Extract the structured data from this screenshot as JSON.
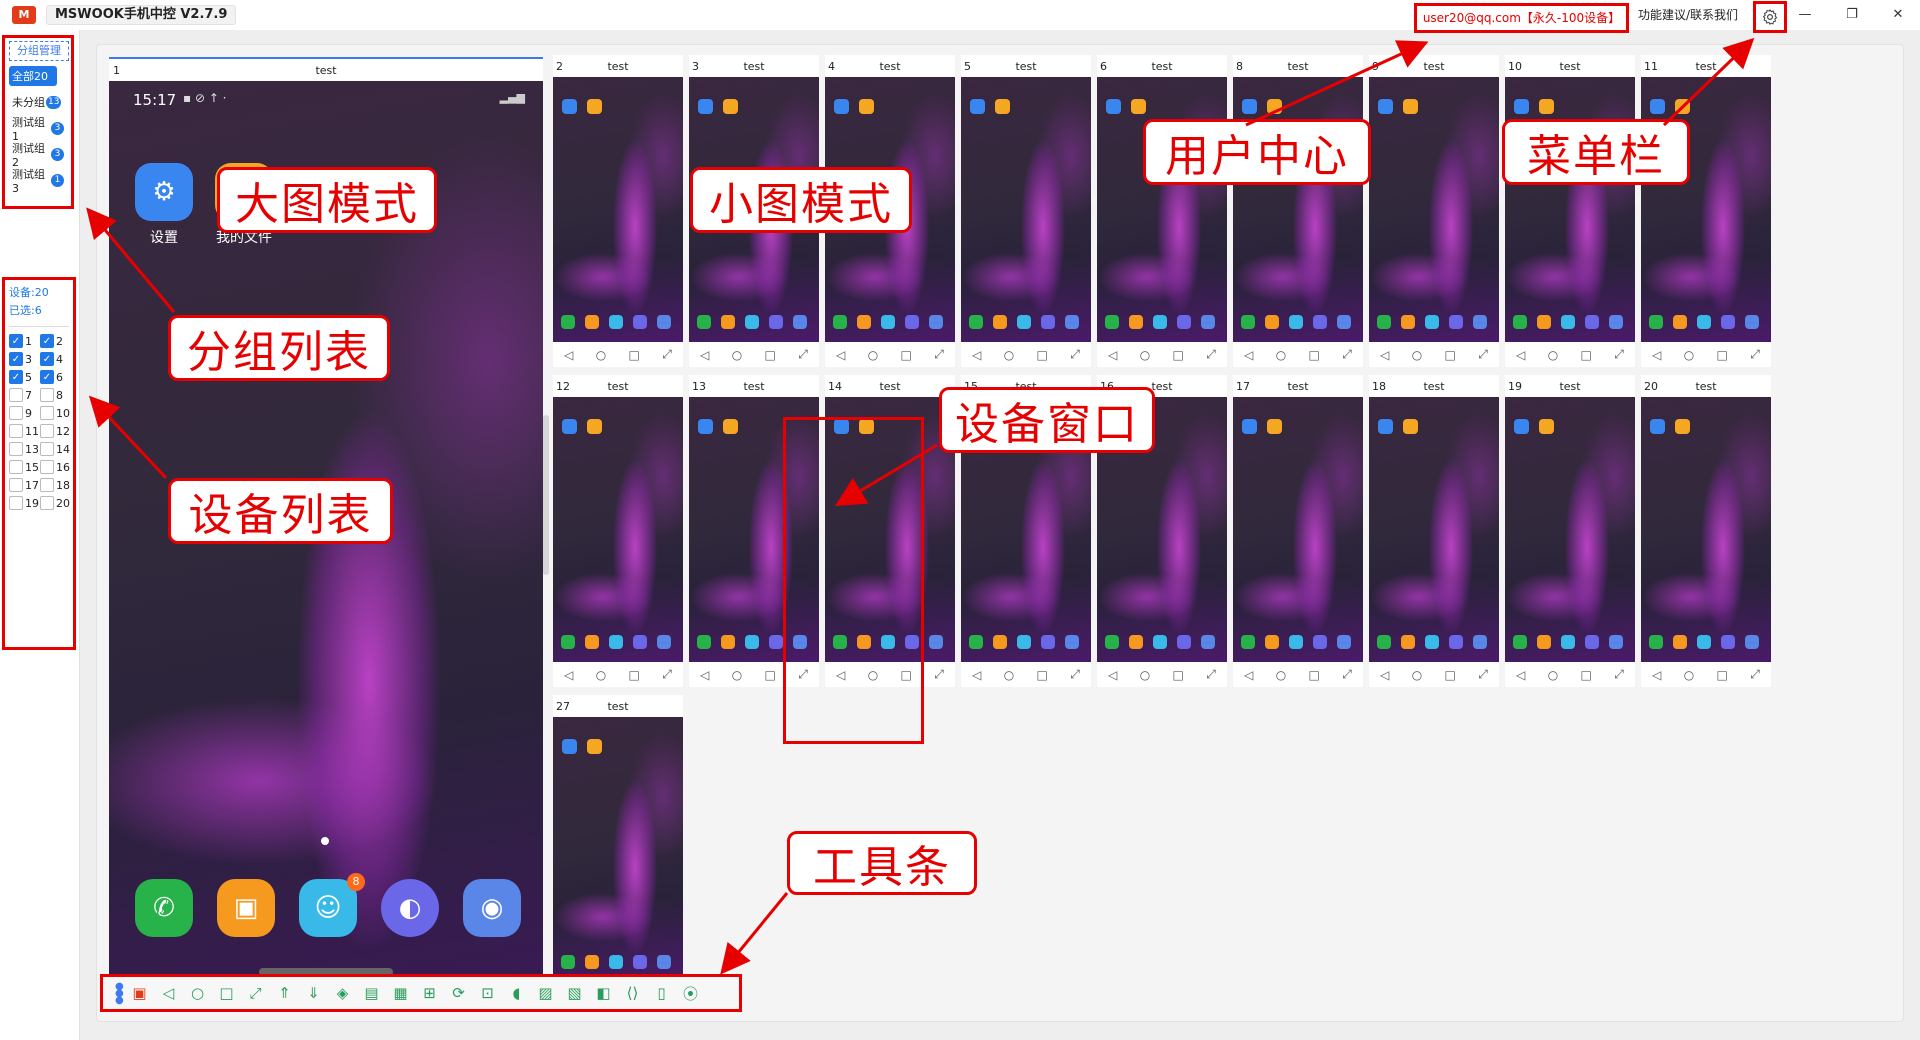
{
  "app": {
    "logo": "M",
    "title": "MSWOOK手机中控 V2.7.9"
  },
  "header": {
    "user_badge": "user20@qq.com【永久-100设备】",
    "feedback": "功能建议/联系我们"
  },
  "groups": {
    "manage": "分组管理",
    "items": [
      {
        "label": "全部",
        "count": "20"
      },
      {
        "label": "未分组",
        "count": "13"
      },
      {
        "label": "测试组1",
        "count": "3"
      },
      {
        "label": "测试组2",
        "count": "3"
      },
      {
        "label": "测试组3",
        "count": "1"
      }
    ]
  },
  "devices": {
    "total": "设备:20",
    "selected": "已选:6",
    "items": [
      {
        "id": "1",
        "checked": true
      },
      {
        "id": "2",
        "checked": true
      },
      {
        "id": "3",
        "checked": true
      },
      {
        "id": "4",
        "checked": true
      },
      {
        "id": "5",
        "checked": true
      },
      {
        "id": "6",
        "checked": true
      },
      {
        "id": "7",
        "checked": false
      },
      {
        "id": "8",
        "checked": false
      },
      {
        "id": "9",
        "checked": false
      },
      {
        "id": "10",
        "checked": false
      },
      {
        "id": "11",
        "checked": false
      },
      {
        "id": "12",
        "checked": false
      },
      {
        "id": "13",
        "checked": false
      },
      {
        "id": "14",
        "checked": false
      },
      {
        "id": "15",
        "checked": false
      },
      {
        "id": "16",
        "checked": false
      },
      {
        "id": "17",
        "checked": false
      },
      {
        "id": "18",
        "checked": false
      },
      {
        "id": "19",
        "checked": false
      },
      {
        "id": "20",
        "checked": false
      }
    ]
  },
  "big_window": {
    "number": "1",
    "name": "test",
    "time": "15:17",
    "apps": [
      {
        "label": "设置"
      },
      {
        "label": "我的文件"
      }
    ],
    "dock_badge": "8"
  },
  "thumbnails": [
    {
      "number": "2",
      "name": "test"
    },
    {
      "number": "3",
      "name": "test"
    },
    {
      "number": "4",
      "name": "test"
    },
    {
      "number": "5",
      "name": "test"
    },
    {
      "number": "6",
      "name": "test"
    },
    {
      "number": "8",
      "name": "test"
    },
    {
      "number": "9",
      "name": "test"
    },
    {
      "number": "10",
      "name": "test"
    },
    {
      "number": "11",
      "name": "test"
    },
    {
      "number": "12",
      "name": "test"
    },
    {
      "number": "13",
      "name": "test"
    },
    {
      "number": "14",
      "name": "test"
    },
    {
      "number": "15",
      "name": "test"
    },
    {
      "number": "16",
      "name": "test"
    },
    {
      "number": "17",
      "name": "test"
    },
    {
      "number": "18",
      "name": "test"
    },
    {
      "number": "19",
      "name": "test"
    },
    {
      "number": "20",
      "name": "test"
    },
    {
      "number": "27",
      "name": "test"
    }
  ],
  "annotations": {
    "large_mode": "大图模式",
    "small_mode": "小图模式",
    "user_center": "用户中心",
    "menu_bar": "菜单栏",
    "group_list": "分组列表",
    "device_window": "设备窗口",
    "device_list": "设备列表",
    "toolbar": "工具条"
  },
  "colors": {
    "accent": "#1f78e6",
    "annotation": "#e60000",
    "toolbar_icon": "#2a9d5c"
  }
}
